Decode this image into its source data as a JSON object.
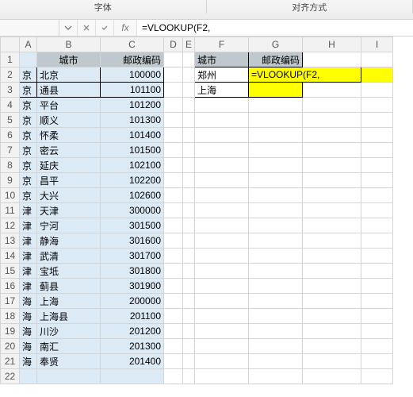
{
  "ribbon": {
    "group_font": "字体",
    "group_align": "对齐方式"
  },
  "formula_bar": {
    "fx_label": "fx",
    "formula": "=VLOOKUP(F2,"
  },
  "columns": [
    "A",
    "B",
    "C",
    "D",
    "E",
    "F",
    "G",
    "H",
    "I"
  ],
  "row_numbers": [
    "1",
    "2",
    "3",
    "4",
    "5",
    "6",
    "7",
    "8",
    "9",
    "10",
    "11",
    "12",
    "13",
    "14",
    "15",
    "16",
    "17",
    "18",
    "19",
    "20",
    "21",
    "22"
  ],
  "main_table": {
    "headers": {
      "city": "城市",
      "zip": "邮政编码"
    },
    "colA_repeat": {
      "jing": "京",
      "jin": "津",
      "hai": "海"
    },
    "rows": [
      {
        "a": "京",
        "city": "北京",
        "zip": "100000"
      },
      {
        "a": "京",
        "city": "通县",
        "zip": "101100"
      },
      {
        "a": "京",
        "city": "平台",
        "zip": "101200"
      },
      {
        "a": "京",
        "city": "顺义",
        "zip": "101300"
      },
      {
        "a": "京",
        "city": "怀柔",
        "zip": "101400"
      },
      {
        "a": "京",
        "city": "密云",
        "zip": "101500"
      },
      {
        "a": "京",
        "city": "延庆",
        "zip": "102100"
      },
      {
        "a": "京",
        "city": "昌平",
        "zip": "102200"
      },
      {
        "a": "京",
        "city": "大兴",
        "zip": "102600"
      },
      {
        "a": "津",
        "city": "天津",
        "zip": "300000"
      },
      {
        "a": "津",
        "city": "宁河",
        "zip": "301500"
      },
      {
        "a": "津",
        "city": "静海",
        "zip": "301600"
      },
      {
        "a": "津",
        "city": "武清",
        "zip": "301700"
      },
      {
        "a": "津",
        "city": "宝坻",
        "zip": "301800"
      },
      {
        "a": "津",
        "city": "蓟县",
        "zip": "301900"
      },
      {
        "a": "海",
        "city": "上海",
        "zip": "200000"
      },
      {
        "a": "海",
        "city": "上海县",
        "zip": "201100"
      },
      {
        "a": "海",
        "city": "川沙",
        "zip": "201200"
      },
      {
        "a": "海",
        "city": "南汇",
        "zip": "201300"
      },
      {
        "a": "海",
        "city": "奉贤",
        "zip": "201400"
      }
    ]
  },
  "lookup_table": {
    "headers": {
      "city": "城市",
      "zip": "邮政编码"
    },
    "rows": [
      {
        "city": "郑州",
        "zip": "=VLOOKUP(F2,"
      },
      {
        "city": "上海",
        "zip": ""
      }
    ]
  },
  "icons": {
    "dropdown": "chevron-down",
    "cancel": "x",
    "confirm": "check"
  },
  "chart_data": {
    "type": "table",
    "title": "城市邮政编码",
    "columns": [
      "城市",
      "邮政编码"
    ],
    "rows": [
      [
        "北京",
        100000
      ],
      [
        "通县",
        101100
      ],
      [
        "平台",
        101200
      ],
      [
        "顺义",
        101300
      ],
      [
        "怀柔",
        101400
      ],
      [
        "密云",
        101500
      ],
      [
        "延庆",
        102100
      ],
      [
        "昌平",
        102200
      ],
      [
        "大兴",
        102600
      ],
      [
        "天津",
        300000
      ],
      [
        "宁河",
        301500
      ],
      [
        "静海",
        301600
      ],
      [
        "武清",
        301700
      ],
      [
        "宝坻",
        301800
      ],
      [
        "蓟县",
        301900
      ],
      [
        "上海",
        200000
      ],
      [
        "上海县",
        201100
      ],
      [
        "川沙",
        201200
      ],
      [
        "南汇",
        201300
      ],
      [
        "奉贤",
        201400
      ]
    ]
  }
}
